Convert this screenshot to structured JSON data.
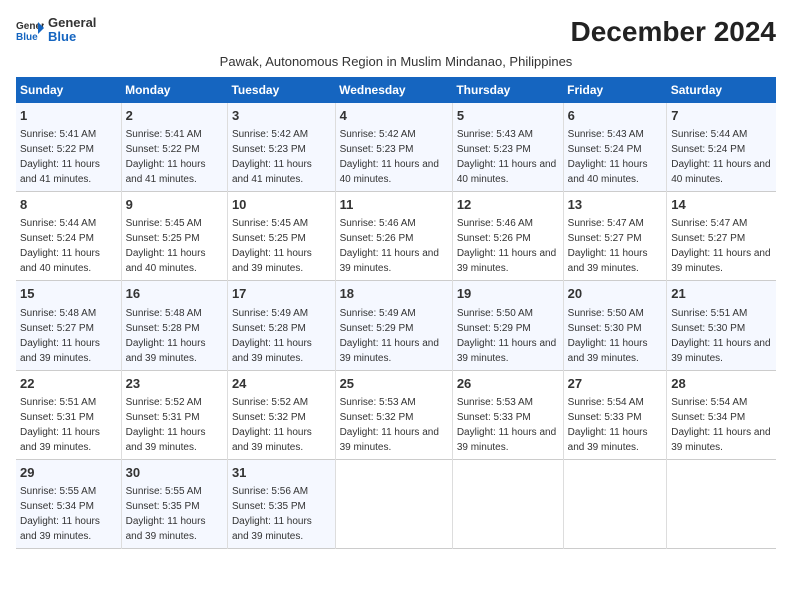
{
  "logo": {
    "line1": "General",
    "line2": "Blue"
  },
  "title": "December 2024",
  "subtitle": "Pawak, Autonomous Region in Muslim Mindanao, Philippines",
  "days_of_week": [
    "Sunday",
    "Monday",
    "Tuesday",
    "Wednesday",
    "Thursday",
    "Friday",
    "Saturday"
  ],
  "weeks": [
    [
      {
        "day": "1",
        "sunrise": "Sunrise: 5:41 AM",
        "sunset": "Sunset: 5:22 PM",
        "daylight": "Daylight: 11 hours and 41 minutes."
      },
      {
        "day": "2",
        "sunrise": "Sunrise: 5:41 AM",
        "sunset": "Sunset: 5:22 PM",
        "daylight": "Daylight: 11 hours and 41 minutes."
      },
      {
        "day": "3",
        "sunrise": "Sunrise: 5:42 AM",
        "sunset": "Sunset: 5:23 PM",
        "daylight": "Daylight: 11 hours and 41 minutes."
      },
      {
        "day": "4",
        "sunrise": "Sunrise: 5:42 AM",
        "sunset": "Sunset: 5:23 PM",
        "daylight": "Daylight: 11 hours and 40 minutes."
      },
      {
        "day": "5",
        "sunrise": "Sunrise: 5:43 AM",
        "sunset": "Sunset: 5:23 PM",
        "daylight": "Daylight: 11 hours and 40 minutes."
      },
      {
        "day": "6",
        "sunrise": "Sunrise: 5:43 AM",
        "sunset": "Sunset: 5:24 PM",
        "daylight": "Daylight: 11 hours and 40 minutes."
      },
      {
        "day": "7",
        "sunrise": "Sunrise: 5:44 AM",
        "sunset": "Sunset: 5:24 PM",
        "daylight": "Daylight: 11 hours and 40 minutes."
      }
    ],
    [
      {
        "day": "8",
        "sunrise": "Sunrise: 5:44 AM",
        "sunset": "Sunset: 5:24 PM",
        "daylight": "Daylight: 11 hours and 40 minutes."
      },
      {
        "day": "9",
        "sunrise": "Sunrise: 5:45 AM",
        "sunset": "Sunset: 5:25 PM",
        "daylight": "Daylight: 11 hours and 40 minutes."
      },
      {
        "day": "10",
        "sunrise": "Sunrise: 5:45 AM",
        "sunset": "Sunset: 5:25 PM",
        "daylight": "Daylight: 11 hours and 39 minutes."
      },
      {
        "day": "11",
        "sunrise": "Sunrise: 5:46 AM",
        "sunset": "Sunset: 5:26 PM",
        "daylight": "Daylight: 11 hours and 39 minutes."
      },
      {
        "day": "12",
        "sunrise": "Sunrise: 5:46 AM",
        "sunset": "Sunset: 5:26 PM",
        "daylight": "Daylight: 11 hours and 39 minutes."
      },
      {
        "day": "13",
        "sunrise": "Sunrise: 5:47 AM",
        "sunset": "Sunset: 5:27 PM",
        "daylight": "Daylight: 11 hours and 39 minutes."
      },
      {
        "day": "14",
        "sunrise": "Sunrise: 5:47 AM",
        "sunset": "Sunset: 5:27 PM",
        "daylight": "Daylight: 11 hours and 39 minutes."
      }
    ],
    [
      {
        "day": "15",
        "sunrise": "Sunrise: 5:48 AM",
        "sunset": "Sunset: 5:27 PM",
        "daylight": "Daylight: 11 hours and 39 minutes."
      },
      {
        "day": "16",
        "sunrise": "Sunrise: 5:48 AM",
        "sunset": "Sunset: 5:28 PM",
        "daylight": "Daylight: 11 hours and 39 minutes."
      },
      {
        "day": "17",
        "sunrise": "Sunrise: 5:49 AM",
        "sunset": "Sunset: 5:28 PM",
        "daylight": "Daylight: 11 hours and 39 minutes."
      },
      {
        "day": "18",
        "sunrise": "Sunrise: 5:49 AM",
        "sunset": "Sunset: 5:29 PM",
        "daylight": "Daylight: 11 hours and 39 minutes."
      },
      {
        "day": "19",
        "sunrise": "Sunrise: 5:50 AM",
        "sunset": "Sunset: 5:29 PM",
        "daylight": "Daylight: 11 hours and 39 minutes."
      },
      {
        "day": "20",
        "sunrise": "Sunrise: 5:50 AM",
        "sunset": "Sunset: 5:30 PM",
        "daylight": "Daylight: 11 hours and 39 minutes."
      },
      {
        "day": "21",
        "sunrise": "Sunrise: 5:51 AM",
        "sunset": "Sunset: 5:30 PM",
        "daylight": "Daylight: 11 hours and 39 minutes."
      }
    ],
    [
      {
        "day": "22",
        "sunrise": "Sunrise: 5:51 AM",
        "sunset": "Sunset: 5:31 PM",
        "daylight": "Daylight: 11 hours and 39 minutes."
      },
      {
        "day": "23",
        "sunrise": "Sunrise: 5:52 AM",
        "sunset": "Sunset: 5:31 PM",
        "daylight": "Daylight: 11 hours and 39 minutes."
      },
      {
        "day": "24",
        "sunrise": "Sunrise: 5:52 AM",
        "sunset": "Sunset: 5:32 PM",
        "daylight": "Daylight: 11 hours and 39 minutes."
      },
      {
        "day": "25",
        "sunrise": "Sunrise: 5:53 AM",
        "sunset": "Sunset: 5:32 PM",
        "daylight": "Daylight: 11 hours and 39 minutes."
      },
      {
        "day": "26",
        "sunrise": "Sunrise: 5:53 AM",
        "sunset": "Sunset: 5:33 PM",
        "daylight": "Daylight: 11 hours and 39 minutes."
      },
      {
        "day": "27",
        "sunrise": "Sunrise: 5:54 AM",
        "sunset": "Sunset: 5:33 PM",
        "daylight": "Daylight: 11 hours and 39 minutes."
      },
      {
        "day": "28",
        "sunrise": "Sunrise: 5:54 AM",
        "sunset": "Sunset: 5:34 PM",
        "daylight": "Daylight: 11 hours and 39 minutes."
      }
    ],
    [
      {
        "day": "29",
        "sunrise": "Sunrise: 5:55 AM",
        "sunset": "Sunset: 5:34 PM",
        "daylight": "Daylight: 11 hours and 39 minutes."
      },
      {
        "day": "30",
        "sunrise": "Sunrise: 5:55 AM",
        "sunset": "Sunset: 5:35 PM",
        "daylight": "Daylight: 11 hours and 39 minutes."
      },
      {
        "day": "31",
        "sunrise": "Sunrise: 5:56 AM",
        "sunset": "Sunset: 5:35 PM",
        "daylight": "Daylight: 11 hours and 39 minutes."
      },
      null,
      null,
      null,
      null
    ]
  ]
}
